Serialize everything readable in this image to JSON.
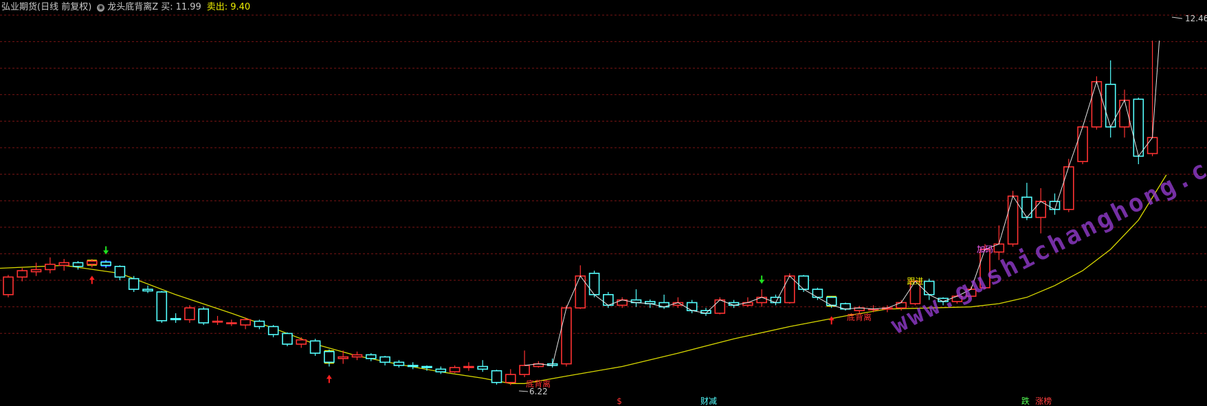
{
  "header": {
    "title": "弘业期货(日线 前复权)",
    "indicator_icon": "circle-dot-icon",
    "indicator_name": "龙头底背离Z",
    "buy_label": "买:",
    "buy_value": "11.99",
    "sell_label": "卖出:",
    "sell_value": "9.40"
  },
  "watermark": "www.gushichanghong.com",
  "colors": {
    "up": "#ff3232",
    "down": "#54ffff",
    "ma": "#d9d900",
    "grid": "#7a1414"
  },
  "chart_data": {
    "type": "candlestick",
    "price_labels": {
      "high": "12.46",
      "low": "6.22"
    },
    "candles": [
      [
        7.45,
        7.78,
        7.4,
        7.82
      ],
      [
        7.78,
        7.9,
        7.7,
        7.95
      ],
      [
        7.88,
        7.92,
        7.8,
        8.05
      ],
      [
        7.92,
        8.02,
        7.85,
        8.15
      ],
      [
        8.0,
        8.05,
        7.9,
        8.12
      ],
      [
        8.05,
        7.98,
        7.92,
        8.08
      ],
      [
        8.02,
        8.08,
        7.96,
        8.12
      ],
      [
        8.06,
        8.0,
        7.95,
        8.1
      ],
      [
        7.98,
        7.78,
        7.72,
        8.0
      ],
      [
        7.75,
        7.55,
        7.5,
        7.8
      ],
      [
        7.55,
        7.52,
        7.48,
        7.62
      ],
      [
        7.5,
        6.96,
        6.92,
        7.52
      ],
      [
        7.0,
        6.98,
        6.92,
        7.1
      ],
      [
        6.98,
        7.2,
        6.92,
        7.25
      ],
      [
        7.18,
        6.92,
        6.88,
        7.22
      ],
      [
        6.95,
        6.95,
        6.88,
        7.05
      ],
      [
        6.92,
        6.92,
        6.86,
        6.98
      ],
      [
        6.88,
        6.98,
        6.8,
        7.02
      ],
      [
        6.95,
        6.85,
        6.8,
        6.98
      ],
      [
        6.85,
        6.7,
        6.65,
        6.88
      ],
      [
        6.72,
        6.52,
        6.48,
        6.74
      ],
      [
        6.52,
        6.6,
        6.45,
        6.65
      ],
      [
        6.58,
        6.35,
        6.3,
        6.62
      ],
      [
        6.38,
        6.18,
        6.1,
        6.42
      ],
      [
        6.25,
        6.28,
        6.15,
        6.4
      ],
      [
        6.28,
        6.32,
        6.22,
        6.38
      ],
      [
        6.32,
        6.25,
        6.2,
        6.35
      ],
      [
        6.28,
        6.18,
        6.12,
        6.3
      ],
      [
        6.18,
        6.12,
        6.08,
        6.22
      ],
      [
        6.12,
        6.1,
        6.05,
        6.18
      ],
      [
        6.1,
        6.08,
        6.02,
        6.12
      ],
      [
        6.05,
        6.0,
        5.96,
        6.1
      ],
      [
        6.0,
        6.08,
        5.98,
        6.12
      ],
      [
        6.08,
        6.1,
        6.02,
        6.18
      ],
      [
        6.1,
        6.05,
        6.0,
        6.22
      ],
      [
        6.02,
        5.8,
        5.76,
        6.04
      ],
      [
        5.8,
        5.95,
        5.75,
        6.05
      ],
      [
        5.95,
        6.12,
        5.9,
        6.4
      ],
      [
        6.1,
        6.15,
        6.08,
        6.2
      ],
      [
        6.15,
        6.12,
        6.08,
        6.25
      ],
      [
        6.15,
        7.2,
        6.1,
        7.25
      ],
      [
        7.2,
        7.8,
        7.18,
        8.0
      ],
      [
        7.85,
        7.45,
        7.4,
        7.9
      ],
      [
        7.45,
        7.25,
        7.2,
        7.5
      ],
      [
        7.25,
        7.35,
        7.2,
        7.4
      ],
      [
        7.35,
        7.3,
        7.22,
        7.55
      ],
      [
        7.32,
        7.28,
        7.2,
        7.36
      ],
      [
        7.3,
        7.22,
        7.18,
        7.45
      ],
      [
        7.25,
        7.3,
        7.2,
        7.4
      ],
      [
        7.3,
        7.15,
        7.1,
        7.35
      ],
      [
        7.15,
        7.1,
        7.05,
        7.2
      ],
      [
        7.1,
        7.35,
        7.08,
        7.4
      ],
      [
        7.3,
        7.25,
        7.2,
        7.35
      ],
      [
        7.25,
        7.3,
        7.22,
        7.4
      ],
      [
        7.3,
        7.4,
        7.22,
        7.55
      ],
      [
        7.4,
        7.3,
        7.25,
        7.45
      ],
      [
        7.3,
        7.8,
        7.28,
        7.85
      ],
      [
        7.8,
        7.55,
        7.5,
        7.82
      ],
      [
        7.55,
        7.4,
        7.35,
        7.58
      ],
      [
        7.4,
        7.25,
        7.2,
        7.42
      ],
      [
        7.28,
        7.18,
        7.15,
        7.3
      ],
      [
        7.15,
        7.2,
        7.1,
        7.24
      ],
      [
        7.18,
        7.18,
        7.12,
        7.25
      ],
      [
        7.18,
        7.2,
        7.12,
        7.25
      ],
      [
        7.2,
        7.3,
        7.15,
        7.35
      ],
      [
        7.28,
        7.7,
        7.25,
        7.72
      ],
      [
        7.7,
        7.45,
        7.35,
        7.75
      ],
      [
        7.38,
        7.32,
        7.25,
        7.4
      ],
      [
        7.32,
        7.42,
        7.28,
        7.45
      ],
      [
        7.42,
        7.55,
        7.38,
        7.6
      ],
      [
        7.58,
        8.3,
        7.55,
        8.4
      ],
      [
        8.25,
        8.4,
        8.1,
        8.75
      ],
      [
        8.4,
        9.3,
        8.35,
        9.4
      ],
      [
        9.28,
        8.9,
        8.85,
        9.55
      ],
      [
        8.9,
        9.2,
        8.6,
        9.45
      ],
      [
        9.2,
        9.05,
        8.95,
        9.35
      ],
      [
        9.05,
        9.85,
        9.0,
        10.0
      ],
      [
        9.95,
        10.6,
        9.9,
        10.6
      ],
      [
        10.6,
        11.45,
        10.55,
        11.55
      ],
      [
        11.4,
        10.6,
        10.4,
        11.85
      ],
      [
        10.6,
        11.1,
        10.4,
        11.3
      ],
      [
        11.12,
        10.05,
        9.9,
        11.15
      ],
      [
        10.1,
        10.4,
        10.05,
        12.22
      ]
    ],
    "ma": [
      [
        -1,
        7.94
      ],
      [
        4,
        8.0
      ],
      [
        8,
        7.85
      ],
      [
        12,
        7.45
      ],
      [
        16,
        7.1
      ],
      [
        19,
        6.82
      ],
      [
        22,
        6.52
      ],
      [
        25,
        6.3
      ],
      [
        28,
        6.14
      ],
      [
        31,
        6.0
      ],
      [
        34,
        5.88
      ],
      [
        36,
        5.78
      ],
      [
        37,
        5.78
      ],
      [
        40,
        5.92
      ],
      [
        44,
        6.1
      ],
      [
        48,
        6.35
      ],
      [
        52,
        6.62
      ],
      [
        56,
        6.85
      ],
      [
        60,
        7.05
      ],
      [
        63,
        7.18
      ],
      [
        66,
        7.2
      ],
      [
        69,
        7.22
      ],
      [
        71,
        7.28
      ],
      [
        73,
        7.4
      ],
      [
        75,
        7.62
      ],
      [
        77,
        7.9
      ],
      [
        79,
        8.3
      ],
      [
        81,
        8.85
      ],
      [
        83,
        9.7
      ]
    ],
    "close_line_from": 37,
    "markers": [
      {
        "type": "arrow-up",
        "index": 6,
        "text": ""
      },
      {
        "type": "arrow-down",
        "index": 7,
        "text": ""
      },
      {
        "type": "arrow-up",
        "index": 23,
        "text": ""
      },
      {
        "type": "arrow-down",
        "index": 54,
        "text": ""
      },
      {
        "type": "arrow-up",
        "index": 59,
        "text": ""
      },
      {
        "type": "label",
        "index": 37,
        "text": "底背离"
      },
      {
        "type": "label",
        "index": 60,
        "text": "底背离"
      },
      {
        "type": "label",
        "index": 65,
        "text": "跟进"
      },
      {
        "type": "label",
        "index": 70,
        "text": "加码"
      }
    ],
    "boxes": [
      {
        "index": 6,
        "color": "#f0f000"
      },
      {
        "index": 7,
        "color": "#1428ff"
      },
      {
        "index": 23,
        "color": "#f0f000"
      },
      {
        "index": 59,
        "color": "#f0f000"
      }
    ],
    "bottom_labels": [
      {
        "text": "$",
        "index": 44,
        "color": "#ff3232"
      },
      {
        "text": "财减",
        "index": 50,
        "color": "#54ffff"
      },
      {
        "text": "跌",
        "index": 73,
        "color": "#54ff54"
      },
      {
        "text": "涨榜",
        "index": 74,
        "color": "#ff4040"
      }
    ],
    "grid": true,
    "ylim": [
      5.5,
      12.7
    ]
  }
}
